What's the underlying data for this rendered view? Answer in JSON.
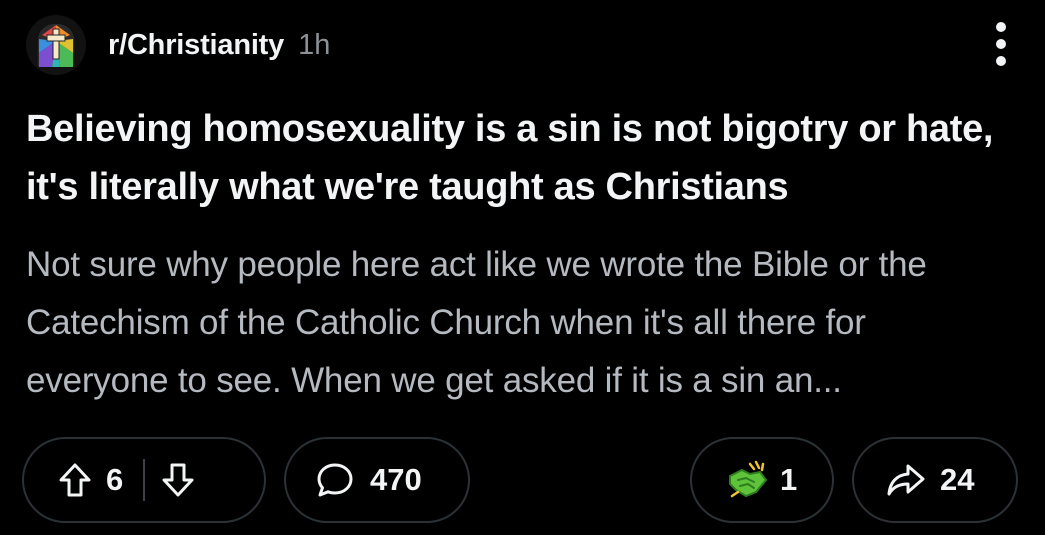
{
  "post": {
    "subreddit": "r/Christianity",
    "age": "1h",
    "title": "Believing homosexuality is a sin is not bigotry or hate, it's literally what we're taught as Christians",
    "body": "Not sure why people here act like we wrote the Bible or the Catechism of the Catholic Church when it's all there for everyone to see. When we get asked if it is a sin an..."
  },
  "actions": {
    "upvotes": "6",
    "comments": "470",
    "awards": "1",
    "shares": "24"
  },
  "colors": {
    "background": "#000000",
    "title_text": "#f2f4f5",
    "body_text": "#b4bac0",
    "muted_text": "#8a9197",
    "pill_border": "#2b3236",
    "award_green": "#5ec23a"
  },
  "icons": {
    "subreddit_avatar": "stained-glass-cross-icon",
    "more": "vertical-dots-icon",
    "upvote": "arrow-up-icon",
    "downvote": "arrow-down-icon",
    "comment": "speech-bubble-icon",
    "award": "handshake-award-icon",
    "share": "share-arrow-icon"
  }
}
